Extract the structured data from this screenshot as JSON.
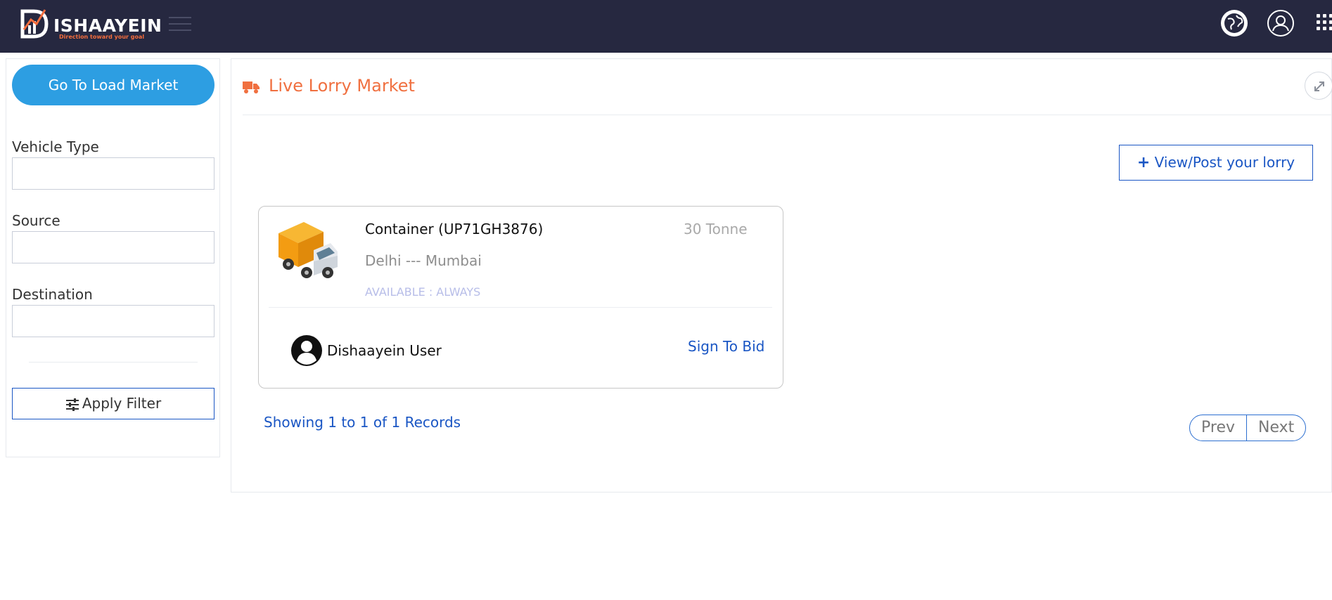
{
  "brand": {
    "name": "ISHAAYEIN",
    "tagline": "Direction toward your goal",
    "accent": "#f07040",
    "nav_bg": "#262840"
  },
  "header": {
    "icons": [
      "menu-icon",
      "globe-icon",
      "user-icon",
      "apps-grid-icon"
    ]
  },
  "sidebar": {
    "load_market_label": "Go To Load Market",
    "filters": [
      {
        "label": "Vehicle Type",
        "value": ""
      },
      {
        "label": "Source",
        "value": ""
      },
      {
        "label": "Destination",
        "value": ""
      }
    ],
    "apply_label": "Apply Filter"
  },
  "main": {
    "title": "Live Lorry Market",
    "post_label": "View/Post your lorry",
    "listing": {
      "vehicle": "Container (UP71GH3876)",
      "capacity": "30 Tonne",
      "route": "Delhi --- Mumbai",
      "availability": "AVAILABLE : ALWAYS",
      "user": "Dishaayein User",
      "action": "Sign To Bid"
    },
    "records_text": "Showing 1 to 1 of 1 Records",
    "pager": {
      "prev": "Prev",
      "next": "Next"
    }
  }
}
